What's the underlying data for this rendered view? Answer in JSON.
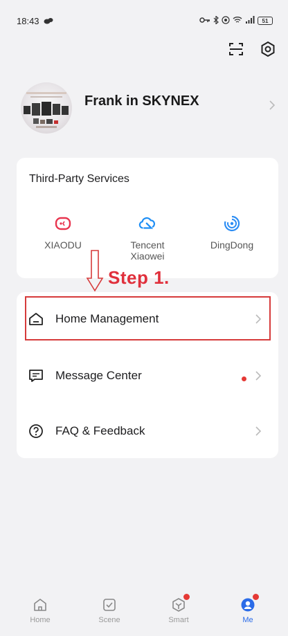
{
  "status_bar": {
    "time": "18:43",
    "battery": "51"
  },
  "profile": {
    "name": "Frank in SKYNEX"
  },
  "services": {
    "title": "Third-Party Services",
    "items": [
      {
        "label": "XIAODU",
        "icon": "xiaodu-icon",
        "color": "#e8344e"
      },
      {
        "label": "Tencent Xiaowei",
        "icon": "tencent-xiaowei-icon",
        "color": "#1e8ef5"
      },
      {
        "label": "DingDong",
        "icon": "dingdong-icon",
        "color": "#2c8df4"
      }
    ]
  },
  "annotation": {
    "step_label": "Step 1.",
    "color": "#e0303c"
  },
  "menu": {
    "items": [
      {
        "label": "Home Management",
        "icon": "home-icon"
      },
      {
        "label": "Message Center",
        "icon": "message-icon",
        "has_badge": true
      },
      {
        "label": "FAQ & Feedback",
        "icon": "help-icon"
      }
    ]
  },
  "tab_bar": {
    "tabs": [
      {
        "label": "Home",
        "icon": "home-tab-icon"
      },
      {
        "label": "Scene",
        "icon": "scene-tab-icon"
      },
      {
        "label": "Smart",
        "icon": "smart-tab-icon",
        "badge": true
      },
      {
        "label": "Me",
        "icon": "me-tab-icon",
        "active": true,
        "badge": true
      }
    ],
    "active_color": "#2b6ce8"
  }
}
